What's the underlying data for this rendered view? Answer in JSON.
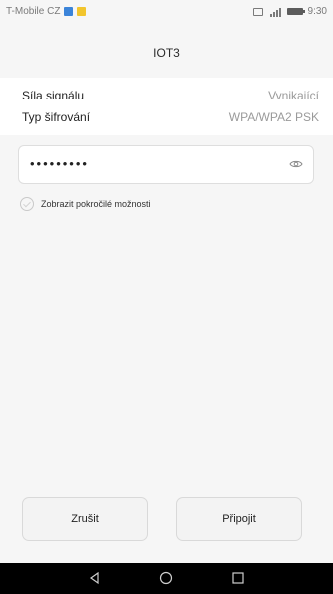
{
  "status_bar": {
    "carrier": "T-Mobile CZ",
    "time": "9:30",
    "notification_icons": [
      "app-notification-blue-icon",
      "app-notification-yellow-icon"
    ],
    "right_icons": [
      "sim-icon",
      "signal-icon",
      "battery-icon"
    ]
  },
  "dialog": {
    "title": "IOT3",
    "rows": [
      {
        "label": "Síla signálu",
        "value": "Vynikající"
      },
      {
        "label": "Typ šifrování",
        "value": "WPA/WPA2 PSK"
      }
    ],
    "password": {
      "value": "•••••••••",
      "toggle_icon": "eye-icon"
    },
    "advanced_options_label": "Zobrazit pokročilé možnosti",
    "buttons": {
      "cancel": "Zrušit",
      "connect": "Připojit"
    }
  },
  "nav_bar": {
    "icons": [
      "back-icon",
      "home-icon",
      "recent-apps-icon"
    ]
  },
  "colors": {
    "background": "#f6f6f6",
    "row_background": "#ffffff",
    "nav_bar": "#000000",
    "secondary_text": "#9a9a9a"
  }
}
